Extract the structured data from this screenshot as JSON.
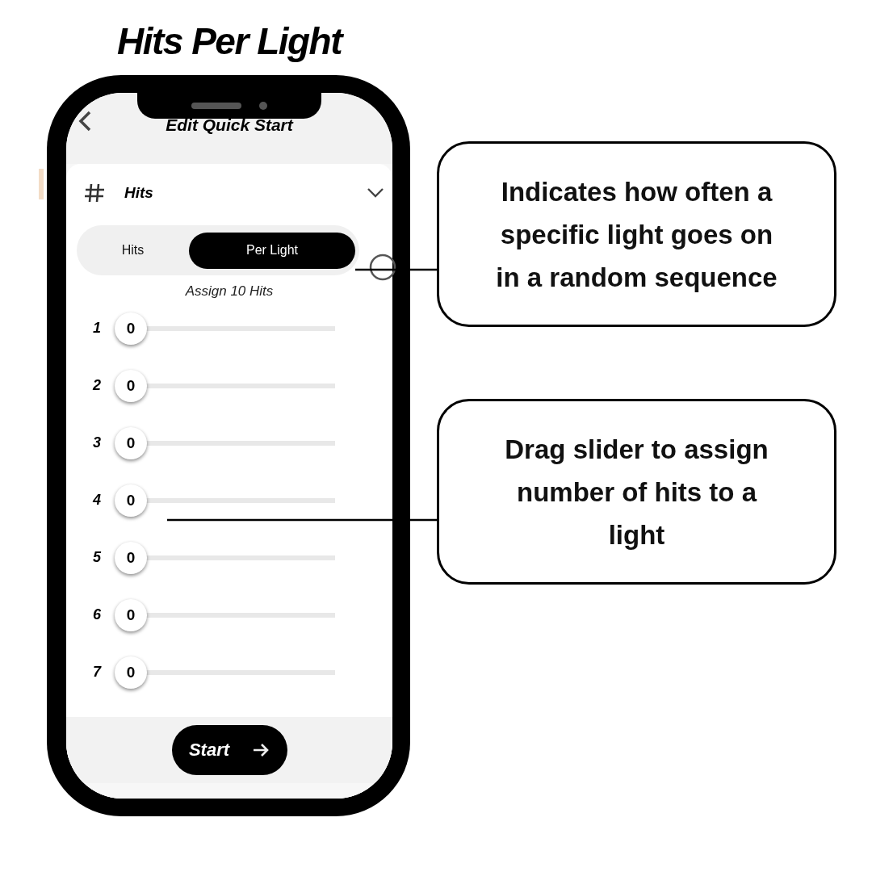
{
  "title": "Hits Per Light",
  "phone": {
    "header": {
      "title": "Edit Quick Start"
    },
    "section": {
      "label": "Hits",
      "expanded": true
    },
    "mode_tabs": [
      {
        "label": "Hits",
        "selected": false
      },
      {
        "label": "Per Light",
        "selected": true
      }
    ],
    "instruction": "Assign 10 Hits",
    "lights": [
      {
        "label": "1",
        "value": "0",
        "level": 0
      },
      {
        "label": "2",
        "value": "0",
        "level": 0
      },
      {
        "label": "3",
        "value": "0",
        "level": 0
      },
      {
        "label": "4",
        "value": "0",
        "level": 0
      },
      {
        "label": "5",
        "value": "0",
        "level": 0
      },
      {
        "label": "6",
        "value": "0",
        "level": 0
      },
      {
        "label": "7",
        "value": "0",
        "level": 0
      }
    ],
    "start_button": "Start"
  },
  "callouts": [
    {
      "text": "Indicates how often a specific light goes on in a random sequence"
    },
    {
      "text": "Drag slider to assign number of hits to a light"
    }
  ]
}
